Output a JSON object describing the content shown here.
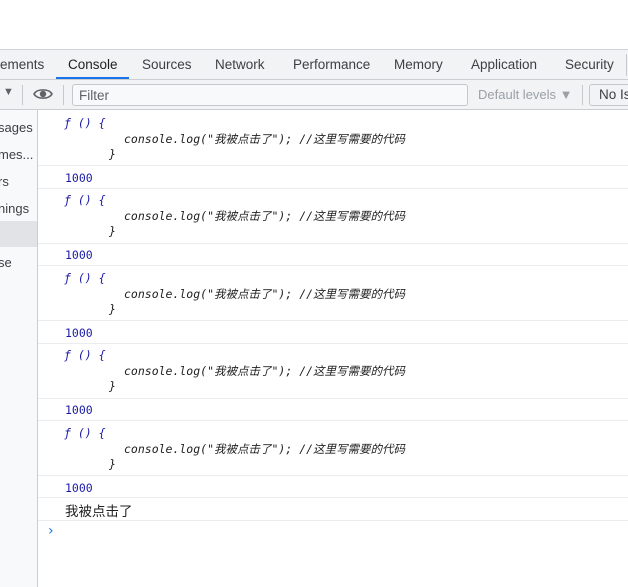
{
  "tabs": [
    "ements",
    "Console",
    "Sources",
    "Network",
    "Performance",
    "Memory",
    "Application",
    "Security"
  ],
  "toolbar": {
    "filter_placeholder": "Filter",
    "levels_label": "Default levels ▼",
    "issues_label": "No Is"
  },
  "sidebar": [
    "sages",
    "mes...",
    "rs",
    "nings",
    "se"
  ],
  "console": {
    "entries": [
      {
        "fn_head": "ƒ () {",
        "body": "console.log(\"我被点击了\"); //这里写需要的代码",
        "close": "}",
        "value": "1000"
      },
      {
        "fn_head": "ƒ () {",
        "body": "console.log(\"我被点击了\"); //这里写需要的代码",
        "close": "}",
        "value": "1000"
      },
      {
        "fn_head": "ƒ () {",
        "body": "console.log(\"我被点击了\"); //这里写需要的代码",
        "close": "}",
        "value": "1000"
      },
      {
        "fn_head": "ƒ () {",
        "body": "console.log(\"我被点击了\"); //这里写需要的代码",
        "close": "}",
        "value": "1000"
      },
      {
        "fn_head": "ƒ () {",
        "body": "console.log(\"我被点击了\"); //这里写需要的代码",
        "close": "}",
        "value": "1000"
      }
    ],
    "log_text": "我被点击了",
    "prompt_symbol": "›"
  },
  "colors": {
    "accent": "#1a73e8",
    "number": "#1a1aa6"
  }
}
